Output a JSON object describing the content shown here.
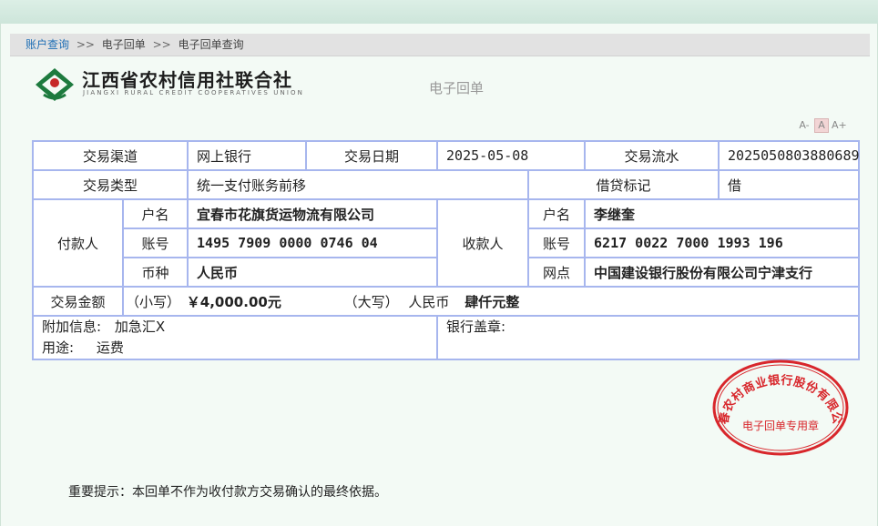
{
  "breadcrumb": {
    "items": [
      "账户查询",
      "电子回单",
      "电子回单查询"
    ],
    "separator": ">>"
  },
  "logo": {
    "name_cn": "江西省农村信用社联合社",
    "name_en": "JIANGXI RURAL CREDIT COOPERATIVES UNION"
  },
  "doc_title": "电子回单",
  "font_size_controls": {
    "smaller": "A-",
    "normal": "A",
    "larger": "A+"
  },
  "receipt": {
    "channel_label": "交易渠道",
    "channel_value": "网上银行",
    "date_label": "交易日期",
    "date_value": "2025-05-08",
    "serial_label": "交易流水",
    "serial_value": "2025050803880689",
    "type_label": "交易类型",
    "type_value": "统一支付账务前移",
    "dc_label": "借贷标记",
    "dc_value": "借",
    "payer_label": "付款人",
    "payee_label": "收款人",
    "name_label": "户名",
    "account_label": "账号",
    "currency_label": "币种",
    "branch_label": "网点",
    "payer_name": "宜春市花旗货运物流有限公司",
    "payer_account": "1495 7909 0000 0746 04",
    "payer_currency": "人民币",
    "payee_name": "李继奎",
    "payee_account": "6217 0022 7000 1993 196",
    "payee_branch": "中国建设银行股份有限公司宁津支行",
    "amount_label": "交易金额",
    "small_label": "（小写）",
    "small_value": "￥4,000.00元",
    "big_label": "（大写）",
    "big_currency": "人民币",
    "big_value": "肆仟元整",
    "extra_label": "附加信息:",
    "extra_value": "加急汇",
    "extra_x": "X",
    "usage_label": "用途:",
    "usage_value": "运费",
    "seal_label": "银行盖章:"
  },
  "stamp": {
    "ring_text": "宜春农村商业银行股份有限公司",
    "center_text": "电子回单专用章",
    "color": "#d8262b"
  },
  "note": "重要提示：本回单不作为收付款方交易确认的最终依据。"
}
